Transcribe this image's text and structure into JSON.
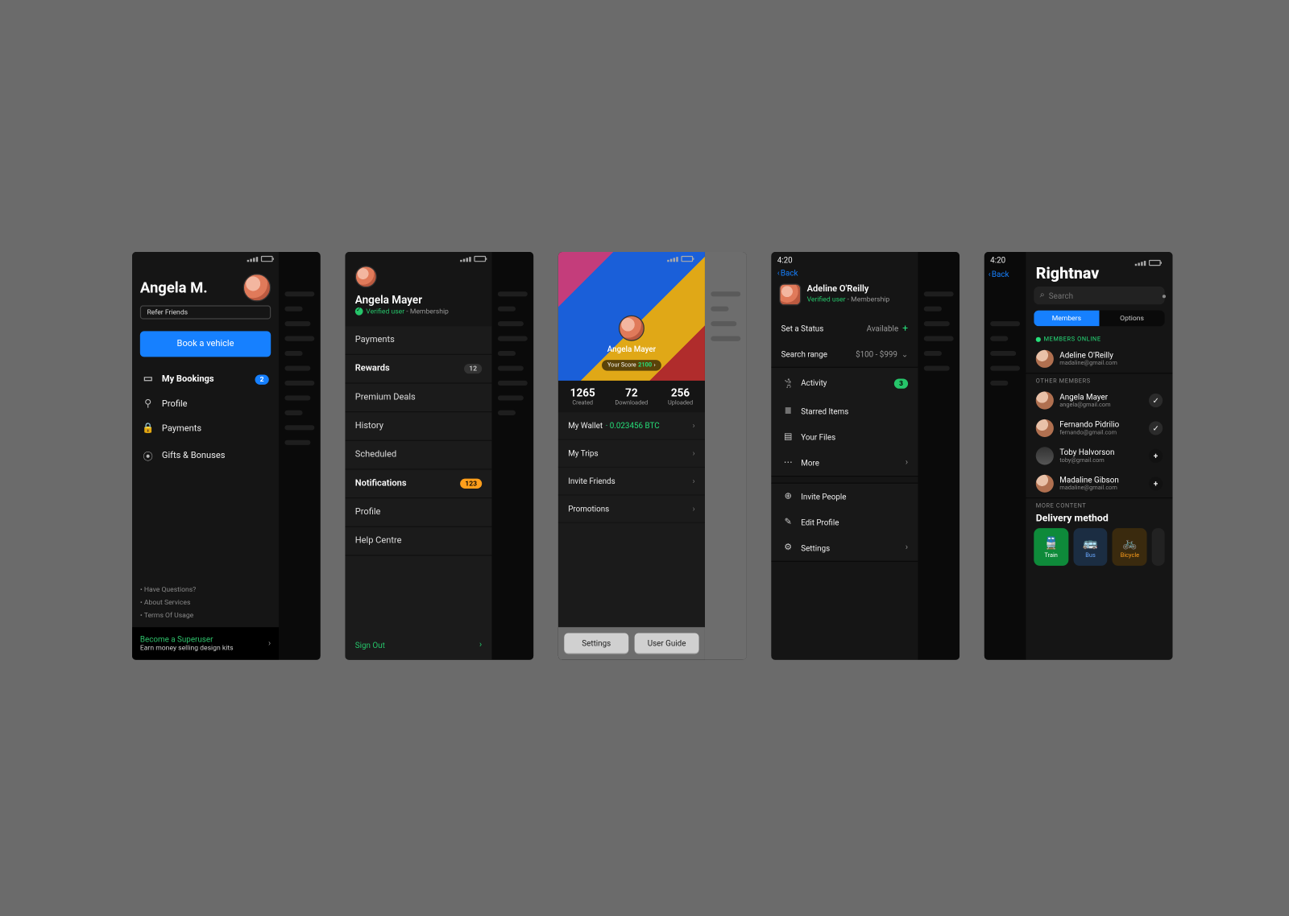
{
  "status": {
    "time": "4:20"
  },
  "s1": {
    "name": "Angela M.",
    "refer": "Refer Friends",
    "cta": "Book a vehicle",
    "menu": [
      {
        "label": "My Bookings",
        "badge": "2",
        "bold": true
      },
      {
        "label": "Profile"
      },
      {
        "label": "Payments"
      },
      {
        "label": "Gifts & Bonuses"
      }
    ],
    "footer": [
      "Have Questions?",
      "About Services",
      "Terms Of Usage"
    ],
    "super": {
      "t1": "Become a Superuser",
      "t2": "Earn money selling design kits"
    }
  },
  "s2": {
    "name": "Angela Mayer",
    "verified": "Verified user",
    "membership": " - Membership",
    "items": [
      {
        "label": "Payments"
      },
      {
        "label": "Rewards",
        "badge_g": "12",
        "bold": true
      },
      {
        "label": "Premium Deals"
      },
      {
        "label": "History"
      },
      {
        "label": "Scheduled"
      },
      {
        "label": "Notifications",
        "badge_o": "123",
        "bold": true
      },
      {
        "label": "Profile"
      },
      {
        "label": "Help Centre"
      }
    ],
    "signout": "Sign Out"
  },
  "s3": {
    "name": "Angela Mayer",
    "score_label": "Your Score ",
    "score": "2100",
    "stats": [
      {
        "v": "1265",
        "l": "Created"
      },
      {
        "v": "72",
        "l": "Downloaded"
      },
      {
        "v": "256",
        "l": "Uploaded"
      }
    ],
    "items": [
      {
        "label": "My Wallet",
        "amt": " · 0.023456 BTC"
      },
      {
        "label": "My Trips"
      },
      {
        "label": "Invite Friends"
      },
      {
        "label": "Promotions"
      }
    ],
    "btn1": "Settings",
    "btn2": "User Guide"
  },
  "s4": {
    "back": "Back",
    "name": "Adeline O'Reilly",
    "verified": "Verified user",
    "membership": " - Membership",
    "row_status": {
      "label": "Set a Status",
      "value": "Available"
    },
    "row_range": {
      "label": "Search range",
      "value": "$100 - $999"
    },
    "sect1": [
      {
        "icon": "walk",
        "label": "Activity",
        "pill": "3"
      },
      {
        "icon": "star",
        "label": "Starred Items"
      },
      {
        "icon": "folder",
        "label": "Your Files"
      },
      {
        "icon": "dots",
        "label": "More",
        "chev": true
      }
    ],
    "sect2": [
      {
        "icon": "plus",
        "label": "Invite People"
      },
      {
        "icon": "edit",
        "label": "Edit Profile"
      },
      {
        "icon": "gear",
        "label": "Settings",
        "chev": true
      }
    ]
  },
  "s5": {
    "back": "Back",
    "title": "Rightnav",
    "search_ph": "Search",
    "seg": {
      "a": "Members",
      "b": "Options"
    },
    "cap_online": "MEMBERS ONLINE",
    "online": {
      "name": "Adeline O'Reilly",
      "email": "madaline@gmail.com"
    },
    "cap_other": "OTHER MEMBERS",
    "others": [
      {
        "name": "Angela Mayer",
        "email": "angela@gmail.com",
        "action": "check"
      },
      {
        "name": "Fernando Pidrilio",
        "email": "fernando@gmail.com",
        "action": "check"
      },
      {
        "name": "Toby Halvorson",
        "email": "toby@gmail.com",
        "action": "add"
      },
      {
        "name": "Madaline Gibson",
        "email": "madaline@gmail.com",
        "action": "add"
      }
    ],
    "cap_more": "MORE CONTENT",
    "dm_title": "Delivery method",
    "dm": [
      {
        "label": "Train"
      },
      {
        "label": "Bus"
      },
      {
        "label": "Bicycle"
      }
    ]
  }
}
